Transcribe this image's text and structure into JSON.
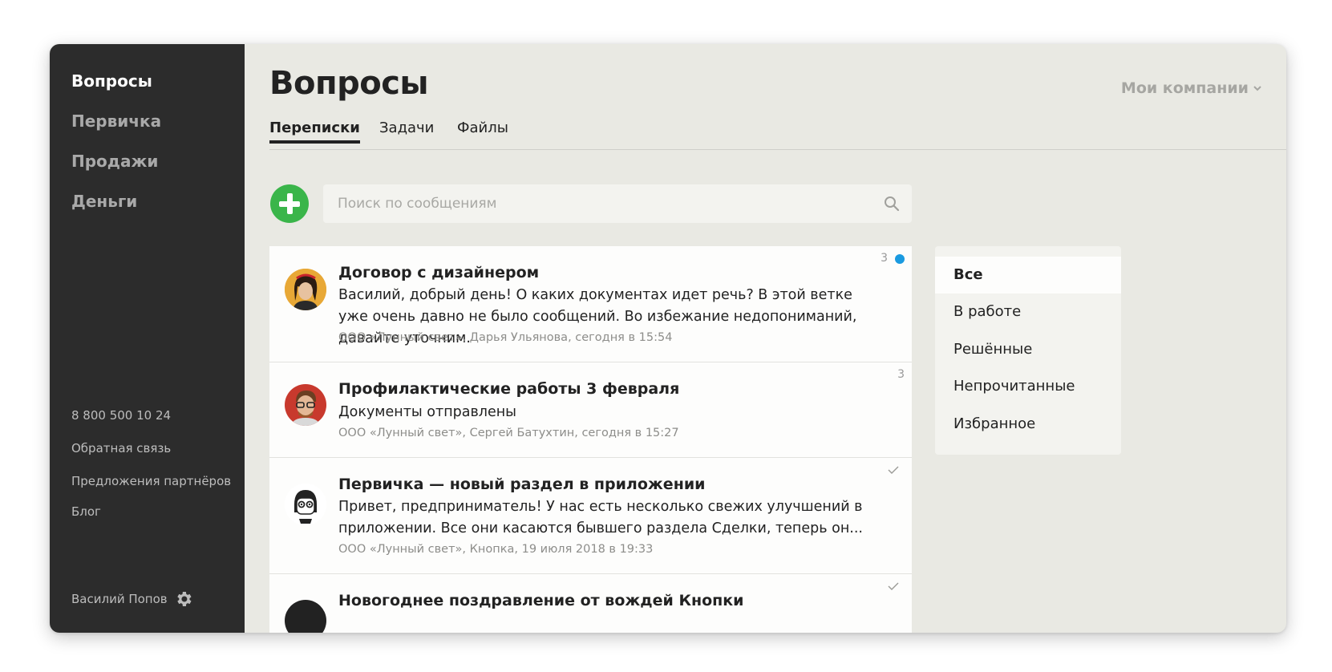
{
  "sidebar": {
    "nav": [
      {
        "label": "Вопросы",
        "active": true
      },
      {
        "label": "Первичка",
        "active": false
      },
      {
        "label": "Продажи",
        "active": false
      },
      {
        "label": "Деньги",
        "active": false
      }
    ],
    "phone": "8 800 500 10 24",
    "links": [
      "Обратная связь",
      "Предложения партнёров",
      "Блог"
    ],
    "user_name": "Василий Попов",
    "settings_icon": "gear-icon"
  },
  "header": {
    "title": "Вопросы",
    "companies_label": "Мои компании",
    "companies_icon": "chevron-down-icon"
  },
  "tabs": [
    {
      "label": "Переписки",
      "active": true
    },
    {
      "label": "Задачи",
      "active": false
    },
    {
      "label": "Файлы",
      "active": false
    }
  ],
  "toolbar": {
    "add_icon": "plus-icon",
    "search_placeholder": "Поиск по сообщениям",
    "search_icon": "search-icon"
  },
  "conversations": [
    {
      "title": "Договор с дизайнером",
      "text": "Василий, добрый день! О каких документах идет речь? В этой ветке уже очень давно не было сообщений. Во избежание недопониманий, давайте уточним.",
      "meta": "ООО «Лунный свет», Дарья Ульянова, сегодня в 15:54",
      "count": "3",
      "unread": true
    },
    {
      "title": "Профилактические работы 3 февраля",
      "text": "Документы отправлены",
      "meta": "ООО «Лунный свет», Сергей Батухтин, сегодня в 15:27",
      "count": "3",
      "unread": false
    },
    {
      "title": "Первичка — новый раздел в приложении",
      "text": "Привет, предприниматель! У нас есть несколько свежих улучшений в приложении. Все они касаются бывшего раздела Сделки, теперь он...",
      "meta": "ООО «Лунный свет», Кнопка, 19 июля 2018 в 19:33",
      "status_icon": "check-icon"
    },
    {
      "title": "Новогоднее поздравление от вождей Кнопки",
      "status_icon": "check-icon"
    }
  ],
  "filters": [
    {
      "label": "Все",
      "active": true
    },
    {
      "label": "В работе",
      "active": false
    },
    {
      "label": "Решённые",
      "active": false
    },
    {
      "label": "Непрочитанные",
      "active": false
    },
    {
      "label": "Избранное",
      "active": false
    }
  ],
  "colors": {
    "sidebar_bg": "#2c2c2c",
    "main_bg": "#e9e9e3",
    "add_button": "#3ab54a",
    "unread_dot": "#1a9ae0"
  }
}
